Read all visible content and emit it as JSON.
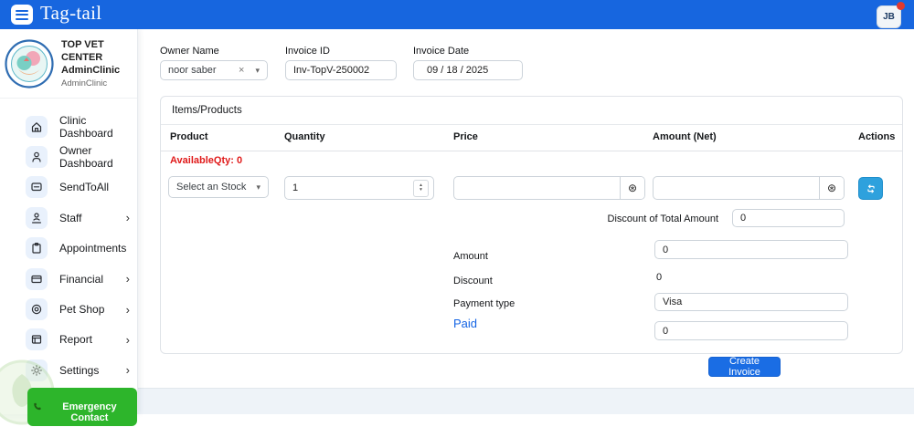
{
  "header": {
    "brand": "Tag-tail",
    "avatar": "JB"
  },
  "clinic": {
    "title": "TOP VET CENTER AdminClinic",
    "subtitle": "AdminClinic"
  },
  "sidebar": {
    "items": [
      {
        "label": "Clinic Dashboard",
        "icon": "home-icon"
      },
      {
        "label": "Owner Dashboard",
        "icon": "person-icon"
      },
      {
        "label": "SendToAll",
        "icon": "chat-icon"
      },
      {
        "label": "Staff",
        "icon": "staff-icon"
      },
      {
        "label": "Appointments",
        "icon": "clipboard-icon"
      },
      {
        "label": "Financial",
        "icon": "card-icon"
      },
      {
        "label": "Pet Shop",
        "icon": "coin-icon"
      },
      {
        "label": "Report",
        "icon": "report-icon"
      },
      {
        "label": "Settings",
        "icon": "gear-icon"
      }
    ],
    "emergency": "Emergency Contact"
  },
  "form": {
    "owner": {
      "label": "Owner Name",
      "value": "noor saber"
    },
    "invoice_id": {
      "label": "Invoice ID",
      "value": "Inv-TopV-250002"
    },
    "invoice_date": {
      "label": "Invoice Date",
      "value": "09 / 18 / 2025"
    }
  },
  "items": {
    "title": "Items/Products",
    "columns": {
      "product": "Product",
      "quantity": "Quantity",
      "price": "Price",
      "amount": "Amount (Net)",
      "actions": "Actions"
    },
    "available_qty": "AvailableQty: 0",
    "row": {
      "product_select": "Select an Stock",
      "quantity": "1"
    },
    "discount_total": {
      "label": "Discount of Total Amount",
      "value": "0"
    },
    "summary": {
      "amount": {
        "label": "Amount",
        "value": "0"
      },
      "discount": {
        "label": "Discount",
        "value": "0"
      },
      "payment": {
        "label": "Payment type",
        "value": "Visa"
      },
      "paid": {
        "label": "Paid",
        "value": "0"
      }
    },
    "create_button": "Create Invoice"
  },
  "icons": {
    "clear": "×",
    "caret": "▾",
    "chevron": "›",
    "currency": "⊛",
    "step_up": "▴",
    "step_down": "▾"
  },
  "colors": {
    "header_blue": "#1766df",
    "primary_blue": "#1a6de4",
    "action_cyan": "#2ea1dd",
    "emergency_green": "#2db52b",
    "alert_red": "#e01b1b",
    "paid_blue": "#1464e4"
  }
}
